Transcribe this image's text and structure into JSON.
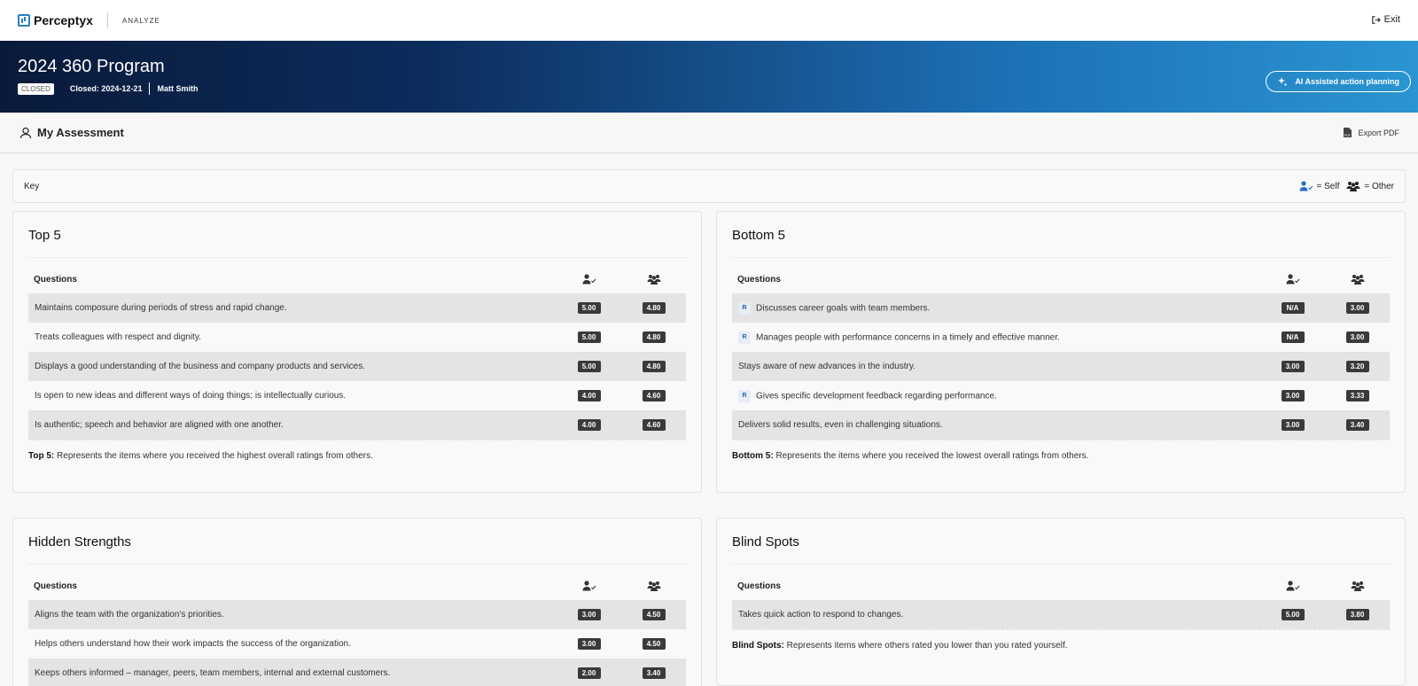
{
  "topbar": {
    "brand": "Perceptyx",
    "module": "ANALYZE",
    "exit_label": "Exit"
  },
  "banner": {
    "title": "2024 360 Program",
    "status": "CLOSED",
    "closed_label": "Closed: 2024-12-21",
    "user": "Matt Smith",
    "ai_button": "AI Assisted action planning"
  },
  "subheader": {
    "title": "My Assessment",
    "export_label": "Export PDF"
  },
  "key": {
    "label": "Key",
    "self_label": "= Self",
    "other_label": "= Other"
  },
  "top5": {
    "title": "Top 5",
    "col_questions": "Questions",
    "rows": [
      {
        "q": "Maintains composure during periods of stress and rapid change.",
        "self": "5.00",
        "other": "4.80",
        "r": false
      },
      {
        "q": "Treats colleagues with respect and dignity.",
        "self": "5.00",
        "other": "4.80",
        "r": false
      },
      {
        "q": "Displays a good understanding of the business and company products and services.",
        "self": "5.00",
        "other": "4.80",
        "r": false
      },
      {
        "q": "Is open to new ideas and different ways of doing things; is intellectually curious.",
        "self": "4.00",
        "other": "4.60",
        "r": false
      },
      {
        "q": "Is authentic; speech and behavior are aligned with one another.",
        "self": "4.00",
        "other": "4.60",
        "r": false
      }
    ],
    "foot_bold": "Top 5:",
    "foot_text": " Represents the items where you received the highest overall ratings from others."
  },
  "bottom5": {
    "title": "Bottom 5",
    "col_questions": "Questions",
    "rows": [
      {
        "q": "Discusses career goals with team members.",
        "self": "N/A",
        "other": "3.00",
        "r": true
      },
      {
        "q": "Manages people with performance concerns in a timely and effective manner.",
        "self": "N/A",
        "other": "3.00",
        "r": true
      },
      {
        "q": "Stays aware of new advances in the industry.",
        "self": "3.00",
        "other": "3.20",
        "r": false
      },
      {
        "q": "Gives specific development feedback regarding performance.",
        "self": "3.00",
        "other": "3.33",
        "r": true
      },
      {
        "q": "Delivers solid results, even in challenging situations.",
        "self": "3.00",
        "other": "3.40",
        "r": false
      }
    ],
    "r_tag": "R",
    "foot_bold": "Bottom 5:",
    "foot_text": " Represents the items where you received the lowest overall ratings from others."
  },
  "hidden": {
    "title": "Hidden Strengths",
    "col_questions": "Questions",
    "rows": [
      {
        "q": "Aligns the team with the organization's priorities.",
        "self": "3.00",
        "other": "4.50",
        "r": false
      },
      {
        "q": "Helps others understand how their work impacts the success of the organization.",
        "self": "3.00",
        "other": "4.50",
        "r": false
      },
      {
        "q": "Keeps others informed – manager, peers, team members, internal and external customers.",
        "self": "2.00",
        "other": "3.40",
        "r": false
      }
    ]
  },
  "blind": {
    "title": "Blind Spots",
    "col_questions": "Questions",
    "rows": [
      {
        "q": "Takes quick action to respond to changes.",
        "self": "5.00",
        "other": "3.80",
        "r": false
      }
    ],
    "foot_bold": "Blind Spots:",
    "foot_text": " Represents items where others rated you lower than you rated yourself."
  }
}
